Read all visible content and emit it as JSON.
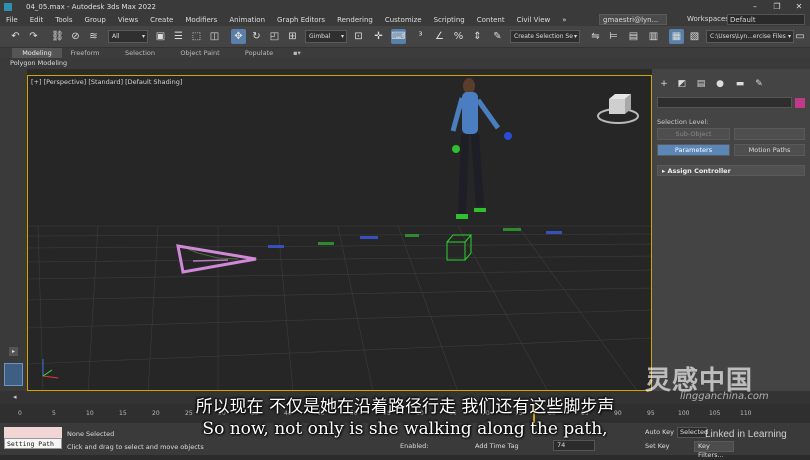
{
  "window": {
    "title": "04_05.max - Autodesk 3ds Max 2022",
    "controls": [
      "–",
      "❐",
      "✕"
    ]
  },
  "menu": {
    "items": [
      "File",
      "Edit",
      "Tools",
      "Group",
      "Views",
      "Create",
      "Modifiers",
      "Animation",
      "Graph Editors",
      "Rendering",
      "Customize",
      "Scripting",
      "Content",
      "Civil View"
    ],
    "more": "»",
    "user": "gmaestri@lyn...",
    "workspaces_label": "Workspaces:",
    "workspace_value": "Default"
  },
  "toolbar": {
    "filter_value": "All",
    "coord_value": "Gimbal",
    "selection_set_placeholder": "Create Selection Se",
    "project_path": "C:\\Users\\Lyn...ercise Files"
  },
  "ribbon": {
    "tabs": [
      "Modeling",
      "Freeform",
      "Selection",
      "Object Paint",
      "Populate"
    ],
    "active_tab": "Modeling",
    "sub_label": "Polygon Modeling"
  },
  "viewport": {
    "label": "[+] [Perspective] [Standard] [Default Shading]"
  },
  "command_panel": {
    "selection_level_label": "Selection Level:",
    "sub_object_label": "Sub-Object",
    "parameters_label": "Parameters",
    "motion_paths_label": "Motion Paths",
    "rollout_label": "Assign Controller",
    "swatch_color": "#c03a8a"
  },
  "timeline": {
    "ticks": [
      "0",
      "5",
      "10",
      "15",
      "20",
      "25",
      "30",
      "35",
      "40",
      "45",
      "50",
      "55",
      "60",
      "65",
      "70",
      "75",
      "80",
      "85",
      "90",
      "95",
      "100",
      "105",
      "110"
    ]
  },
  "status": {
    "setting_path": "Setting Path",
    "selection_status": "None Selected",
    "prompt": "Click and drag to select and move objects",
    "enabled_label": "Enabled:",
    "add_time_tag": "Add Time Tag",
    "frame_value": "74",
    "auto_key": "Auto Key",
    "selected_value": "Selected",
    "set_key": "Set Key",
    "key_filters": "Key Filters..."
  },
  "subtitles": {
    "cn": "所以现在 不仅是她在沿着路径行走 我们还有这些脚步声",
    "en": "So now, not only is she walking along the path,"
  },
  "watermarks": {
    "cn": "灵感中国",
    "url": "lingganchina.com",
    "linkedin": "Linked in Learning"
  }
}
